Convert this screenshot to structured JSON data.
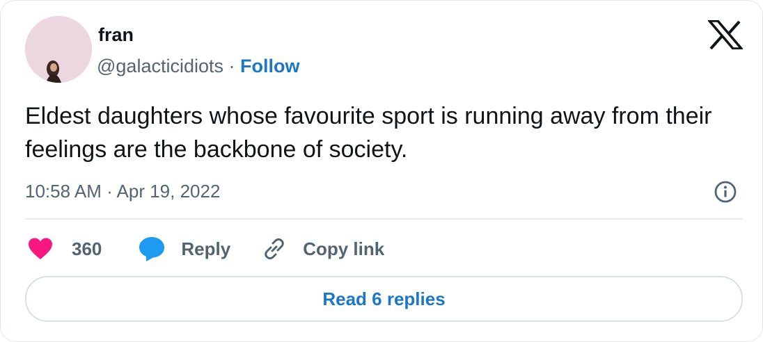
{
  "author": {
    "name": "fran",
    "handle": "@galacticidiots",
    "separator": " · ",
    "follow_label": "Follow"
  },
  "tweet": {
    "text": "Eldest daughters whose favourite sport is running away from their feelings are the backbone of society.",
    "timestamp": "10:58 AM · Apr 19, 2022"
  },
  "actions": {
    "like_count": "360",
    "reply_label": "Reply",
    "copy_link_label": "Copy link"
  },
  "read_replies_label": "Read 6 replies",
  "icons": [
    "x-logo-icon",
    "info-icon",
    "heart-icon",
    "reply-bubble-icon",
    "link-icon"
  ],
  "colors": {
    "like": "#f91880",
    "link_blue": "#1d77c8",
    "reply_bubble": "#1d9bf0",
    "muted_text": "#536471",
    "text": "#0f1419"
  }
}
